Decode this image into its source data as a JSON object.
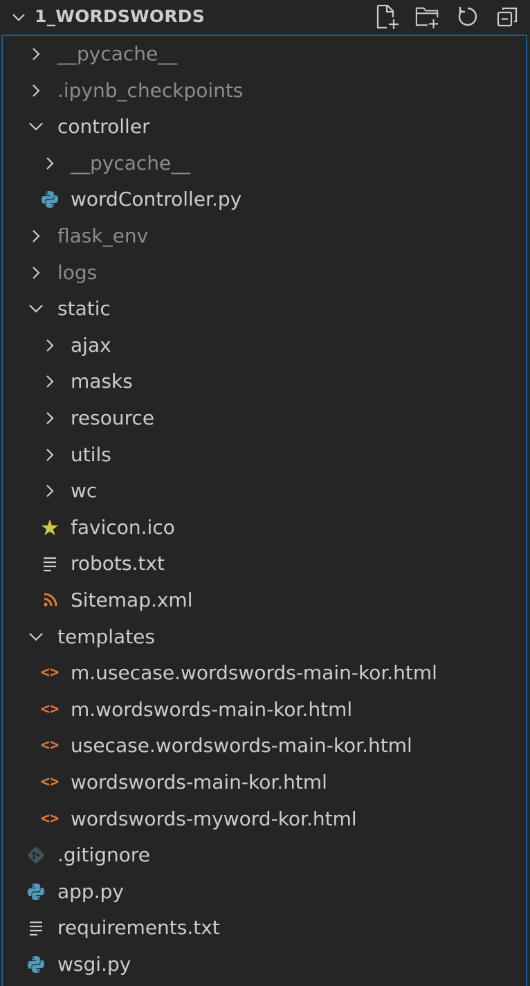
{
  "explorer": {
    "title": "1_WORDSWORDS",
    "actions": [
      {
        "name": "new-file-icon"
      },
      {
        "name": "new-folder-icon"
      },
      {
        "name": "refresh-icon"
      },
      {
        "name": "collapse-all-icon"
      }
    ]
  },
  "colors": {
    "background": "#252526",
    "text": "#cccccc",
    "dim_text": "#8c8c8c",
    "focus_border": "#0e639c",
    "python_icon": "#519aba",
    "html_icon": "#e37933",
    "favicon_icon": "#cbcb41",
    "xml_icon": "#e37933"
  },
  "tree": [
    {
      "label": "__pycache__",
      "kind": "folder",
      "open": false,
      "depth": 1,
      "dim": true
    },
    {
      "label": ".ipynb_checkpoints",
      "kind": "folder",
      "open": false,
      "depth": 1,
      "dim": true
    },
    {
      "label": "controller",
      "kind": "folder",
      "open": true,
      "depth": 1,
      "dim": false
    },
    {
      "label": "__pycache__",
      "kind": "folder",
      "open": false,
      "depth": 2,
      "dim": true
    },
    {
      "label": "wordController.py",
      "kind": "python",
      "depth": 2,
      "dim": false
    },
    {
      "label": "flask_env",
      "kind": "folder",
      "open": false,
      "depth": 1,
      "dim": true
    },
    {
      "label": "logs",
      "kind": "folder",
      "open": false,
      "depth": 1,
      "dim": true
    },
    {
      "label": "static",
      "kind": "folder",
      "open": true,
      "depth": 1,
      "dim": false
    },
    {
      "label": "ajax",
      "kind": "folder",
      "open": false,
      "depth": 2,
      "dim": false
    },
    {
      "label": "masks",
      "kind": "folder",
      "open": false,
      "depth": 2,
      "dim": false
    },
    {
      "label": "resource",
      "kind": "folder",
      "open": false,
      "depth": 2,
      "dim": false
    },
    {
      "label": "utils",
      "kind": "folder",
      "open": false,
      "depth": 2,
      "dim": false
    },
    {
      "label": "wc",
      "kind": "folder",
      "open": false,
      "depth": 2,
      "dim": false
    },
    {
      "label": "favicon.ico",
      "kind": "favicon",
      "depth": 2,
      "dim": false
    },
    {
      "label": "robots.txt",
      "kind": "text",
      "depth": 2,
      "dim": false
    },
    {
      "label": "Sitemap.xml",
      "kind": "rss",
      "depth": 2,
      "dim": false
    },
    {
      "label": "templates",
      "kind": "folder",
      "open": true,
      "depth": 1,
      "dim": false
    },
    {
      "label": "m.usecase.wordswords-main-kor.html",
      "kind": "html",
      "depth": 2,
      "dim": false
    },
    {
      "label": "m.wordswords-main-kor.html",
      "kind": "html",
      "depth": 2,
      "dim": false
    },
    {
      "label": "usecase.wordswords-main-kor.html",
      "kind": "html",
      "depth": 2,
      "dim": false
    },
    {
      "label": "wordswords-main-kor.html",
      "kind": "html",
      "depth": 2,
      "dim": false
    },
    {
      "label": "wordswords-myword-kor.html",
      "kind": "html",
      "depth": 2,
      "dim": false
    },
    {
      "label": ".gitignore",
      "kind": "git",
      "depth": 1,
      "dim": false
    },
    {
      "label": "app.py",
      "kind": "python",
      "depth": 1,
      "dim": false
    },
    {
      "label": "requirements.txt",
      "kind": "text",
      "depth": 1,
      "dim": false
    },
    {
      "label": "wsgi.py",
      "kind": "python",
      "depth": 1,
      "dim": false
    }
  ]
}
